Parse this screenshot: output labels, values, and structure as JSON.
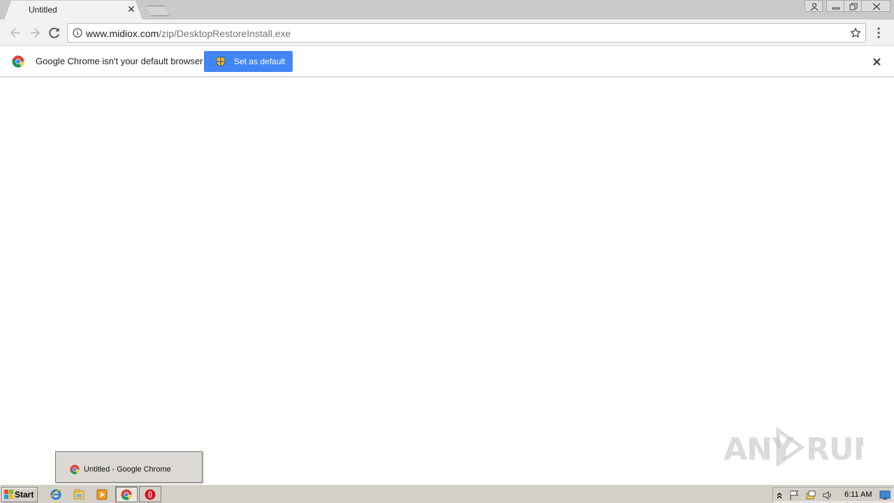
{
  "browser": {
    "tab": {
      "title": "Untitled",
      "close_symbol": "✕"
    },
    "omnibox": {
      "host": "www.midiox.com",
      "path": "/zip/DesktopRestoreInstall.exe"
    },
    "infobar": {
      "message": "Google Chrome isn't your default browser",
      "button_label": "Set as default",
      "button_color": "#4285f4"
    }
  },
  "taskbar": {
    "start_label": "Start",
    "preview_label": "Untitled - Google Chrome",
    "clock": "6:11 AM",
    "pinned": [
      "ie-icon",
      "explorer-icon",
      "media-player-icon",
      "chrome-icon",
      "opera-icon"
    ]
  },
  "watermark": {
    "text": "ANY RUN"
  }
}
